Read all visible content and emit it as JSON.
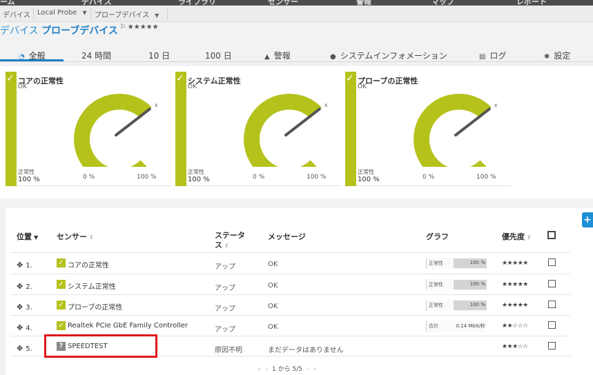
{
  "topnav": {
    "items": [
      "ーム",
      "デバイス",
      "ライブラリ",
      "センサー",
      "警報",
      "マップ",
      "レポート"
    ]
  },
  "breadcrumb": {
    "items": [
      "デバイス",
      "Local Probe",
      "プローブデバイス"
    ]
  },
  "title": {
    "prefix": "デバイス",
    "name": "プローブデバイス",
    "flag": "⚐",
    "stars": "★★★★★"
  },
  "tabs": [
    {
      "icon": "◔",
      "label": "全般"
    },
    {
      "icon": "",
      "label": "24 時間"
    },
    {
      "icon": "",
      "label": "10 日"
    },
    {
      "icon": "",
      "label": "100 日"
    },
    {
      "icon": "▲",
      "label": "警報"
    },
    {
      "icon": "●",
      "label": "システムインフォメーション"
    },
    {
      "icon": "▤",
      "label": "ログ"
    },
    {
      "icon": "✱",
      "label": "設定"
    }
  ],
  "gauges": [
    {
      "name": "コアの正常性",
      "status": "OK",
      "health_label": "正常性",
      "value": "100 %",
      "min": "0 %",
      "max": "100 %",
      "marker": "x",
      "level": 1.0
    },
    {
      "name": "システム正常性",
      "status": "OK",
      "health_label": "正常性",
      "value": "100 %",
      "min": "0 %",
      "max": "100 %",
      "marker": "x",
      "level": 1.0
    },
    {
      "name": "プローブの正常性",
      "status": "OK",
      "health_label": "正常性",
      "value": "100 %",
      "min": "0 %",
      "max": "100 %",
      "marker": "x",
      "level": 1.0
    }
  ],
  "table": {
    "headers": {
      "position": "位置",
      "sensor": "センサー",
      "status_line1": "ステータ",
      "status_line2": "ス",
      "message": "メッセージ",
      "graph": "グラフ",
      "priority": "優先度"
    },
    "rows": [
      {
        "pos": "1.",
        "check": "✓",
        "sensor": "コアの正常性",
        "status": "アップ",
        "message": "OK",
        "graph_label": "正常性",
        "graph_value": "100 %",
        "graph_fill": 0.55,
        "priority": "★★★★★"
      },
      {
        "pos": "2.",
        "check": "✓",
        "sensor": "システム正常性",
        "status": "アップ",
        "message": "OK",
        "graph_label": "正常性",
        "graph_value": "100 %",
        "graph_fill": 0.55,
        "priority": "★★★★★"
      },
      {
        "pos": "3.",
        "check": "✓",
        "sensor": "プローブの正常性",
        "status": "アップ",
        "message": "OK",
        "graph_label": "正常性",
        "graph_value": "100 %",
        "graph_fill": 0.55,
        "priority": "★★★★★"
      },
      {
        "pos": "4.",
        "check": "✓",
        "sensor": "Realtek PCIe GbE Family Controller",
        "status": "アップ",
        "message": "OK",
        "graph_label": "合計",
        "graph_value": "0.14 Mbit/秒",
        "graph_fill": 0,
        "priority": "★★☆☆☆"
      },
      {
        "pos": "5.",
        "check": "?",
        "sensor": "SPEEDTEST",
        "status": "原因不明",
        "message": "まだデータはありません",
        "graph_label": "",
        "graph_value": "",
        "graph_fill": 0,
        "priority": "★★★☆☆"
      }
    ]
  },
  "pager": {
    "text": "1 から 5/5"
  },
  "colors": {
    "accent": "#1d7fc8",
    "gauge": "#b5c21c",
    "highlight": "#e0161a"
  }
}
